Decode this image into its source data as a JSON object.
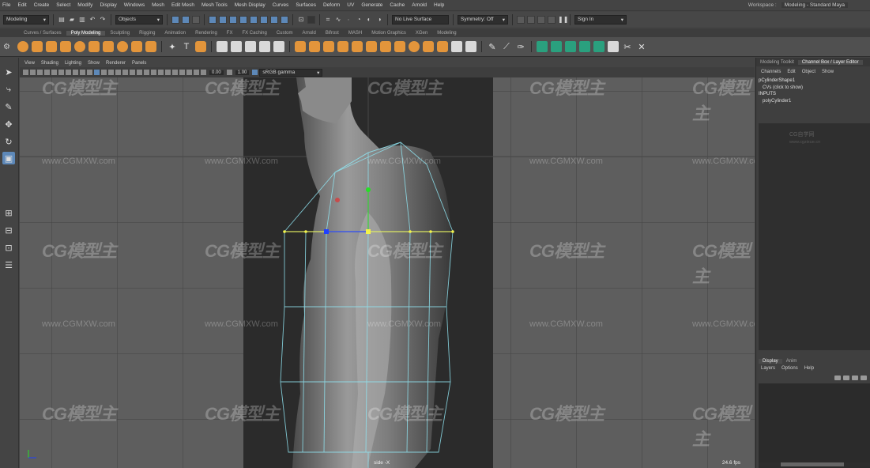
{
  "menubar": {
    "items": [
      "File",
      "Edit",
      "Create",
      "Select",
      "Modify",
      "Display",
      "Windows",
      "Mesh",
      "Edit Mesh",
      "Mesh Tools",
      "Mesh Display",
      "Curves",
      "Surfaces",
      "Deform",
      "UV",
      "Generate",
      "Cache",
      "Arnold",
      "Help"
    ],
    "workspace_label": "Workspace :",
    "workspace_value": "Modeling - Standard Maya"
  },
  "statusline": {
    "mode": "Modeling",
    "selection_mode": "Objects",
    "live_surface": "No Live Surface",
    "symmetry": "Symmetry: Off",
    "sign_in": "Sign In"
  },
  "shelf": {
    "tabs": [
      "Curves / Surfaces",
      "Poly Modeling",
      "Sculpting",
      "Rigging",
      "Animation",
      "Rendering",
      "FX",
      "FX Caching",
      "Custom",
      "Arnold",
      "Bifrost",
      "MASH",
      "Motion Graphics",
      "XGen",
      "Modeling"
    ],
    "active_tab": "Poly Modeling"
  },
  "toolbox": {
    "tools": [
      {
        "name": "select-tool-icon",
        "glyph": "➤"
      },
      {
        "name": "lasso-tool-icon",
        "glyph": "⤷"
      },
      {
        "name": "paint-select-tool-icon",
        "glyph": "✎"
      },
      {
        "name": "move-tool-icon",
        "glyph": "✥"
      },
      {
        "name": "rotate-tool-icon",
        "glyph": "↻"
      },
      {
        "name": "scale-tool-icon",
        "glyph": "▣"
      }
    ]
  },
  "viewport": {
    "panel_menu": [
      "View",
      "Shading",
      "Lighting",
      "Show",
      "Renderer",
      "Panels"
    ],
    "field_1": "0.00",
    "field_2": "1.00",
    "color_space": "sRGB gamma",
    "camera_label": "side -X",
    "fps": "24.6 fps",
    "watermark_logo": "CG模型主",
    "watermark_url": "www.CGMXW.com"
  },
  "right_panel": {
    "tabs": [
      "Modeling Toolkit",
      "Channel Box / Layer Editor"
    ],
    "active_tab": "Channel Box / Layer Editor",
    "menu": [
      "Channels",
      "Edit",
      "Object",
      "Show"
    ],
    "lines": [
      "pCylinderShape1",
      "CVs (click to show)",
      "INPUTS",
      "polyCylinder1"
    ],
    "watermark_title": "CG自学网",
    "watermark_url": "www.cgzixue.cn",
    "layer_tabs": [
      "Display",
      "Anim"
    ],
    "active_layer_tab": "Display",
    "layer_menu": [
      "Layers",
      "Options",
      "Help"
    ]
  },
  "colors": {
    "accent_blue": "#5d88b8",
    "shelf_orange": "#e3953b",
    "shelf_teal": "#2aa07e",
    "wire_cyan": "#8fe3f0",
    "vertex_yellow": "#f3f34a",
    "manip_green": "#25e025",
    "manip_red": "#e03030",
    "manip_blue": "#2040ff"
  }
}
